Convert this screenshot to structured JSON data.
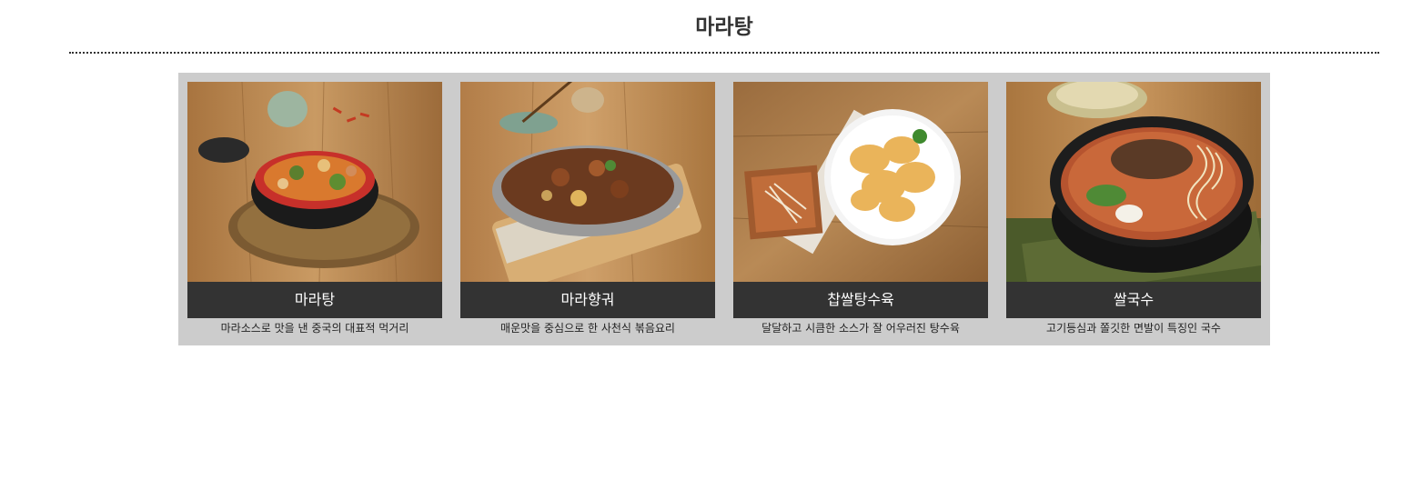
{
  "page": {
    "title": "마라탕"
  },
  "menu": {
    "items": [
      {
        "name": "마라탕",
        "description": "마라소스로 맛을 낸 중국의 대표적 먹거리",
        "photo_icon": "malatang-bowl-photo"
      },
      {
        "name": "마라향궈",
        "description": "매운맛을 중심으로 한 사천식 볶음요리",
        "photo_icon": "malaxiangguo-pan-photo"
      },
      {
        "name": "찹쌀탕수육",
        "description": "달달하고 시큼한 소스가 잘 어우러진 탕수육",
        "photo_icon": "sweet-sour-pork-plate-photo"
      },
      {
        "name": "쌀국수",
        "description": "고기등심과 쫄깃한 면발이 특징인 국수",
        "photo_icon": "rice-noodle-pot-photo"
      }
    ]
  },
  "colors": {
    "panel_bg": "#cccccc",
    "label_bg": "#333333",
    "label_text": "#ffffff",
    "wood": "#b98a56"
  }
}
